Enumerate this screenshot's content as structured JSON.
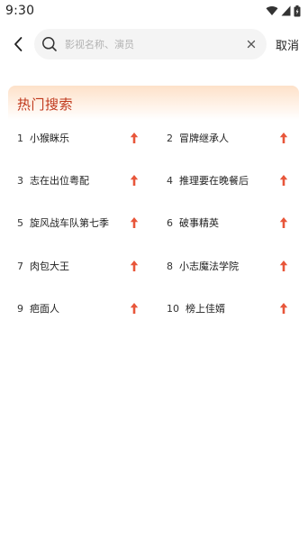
{
  "status_bar": {
    "time": "9:30"
  },
  "search": {
    "placeholder": "影视名称、演员",
    "value": "",
    "cancel_label": "取消"
  },
  "hot_search": {
    "title": "热门搜索",
    "items": [
      {
        "rank": "1",
        "name": "小猴眯乐"
      },
      {
        "rank": "2",
        "name": "冒牌继承人"
      },
      {
        "rank": "3",
        "name": "志在出位粤配"
      },
      {
        "rank": "4",
        "name": "推理要在晚餐后"
      },
      {
        "rank": "5",
        "name": "旋风战车队第七季"
      },
      {
        "rank": "6",
        "name": "破事精英"
      },
      {
        "rank": "7",
        "name": "肉包大王"
      },
      {
        "rank": "8",
        "name": "小志魔法学院"
      },
      {
        "rank": "9",
        "name": "疤面人"
      },
      {
        "rank": "10",
        "name": "榜上佳婿"
      }
    ],
    "trend_icon": "arrow-up-icon",
    "trend_color": "#e8563a",
    "title_color": "#c0391c"
  }
}
